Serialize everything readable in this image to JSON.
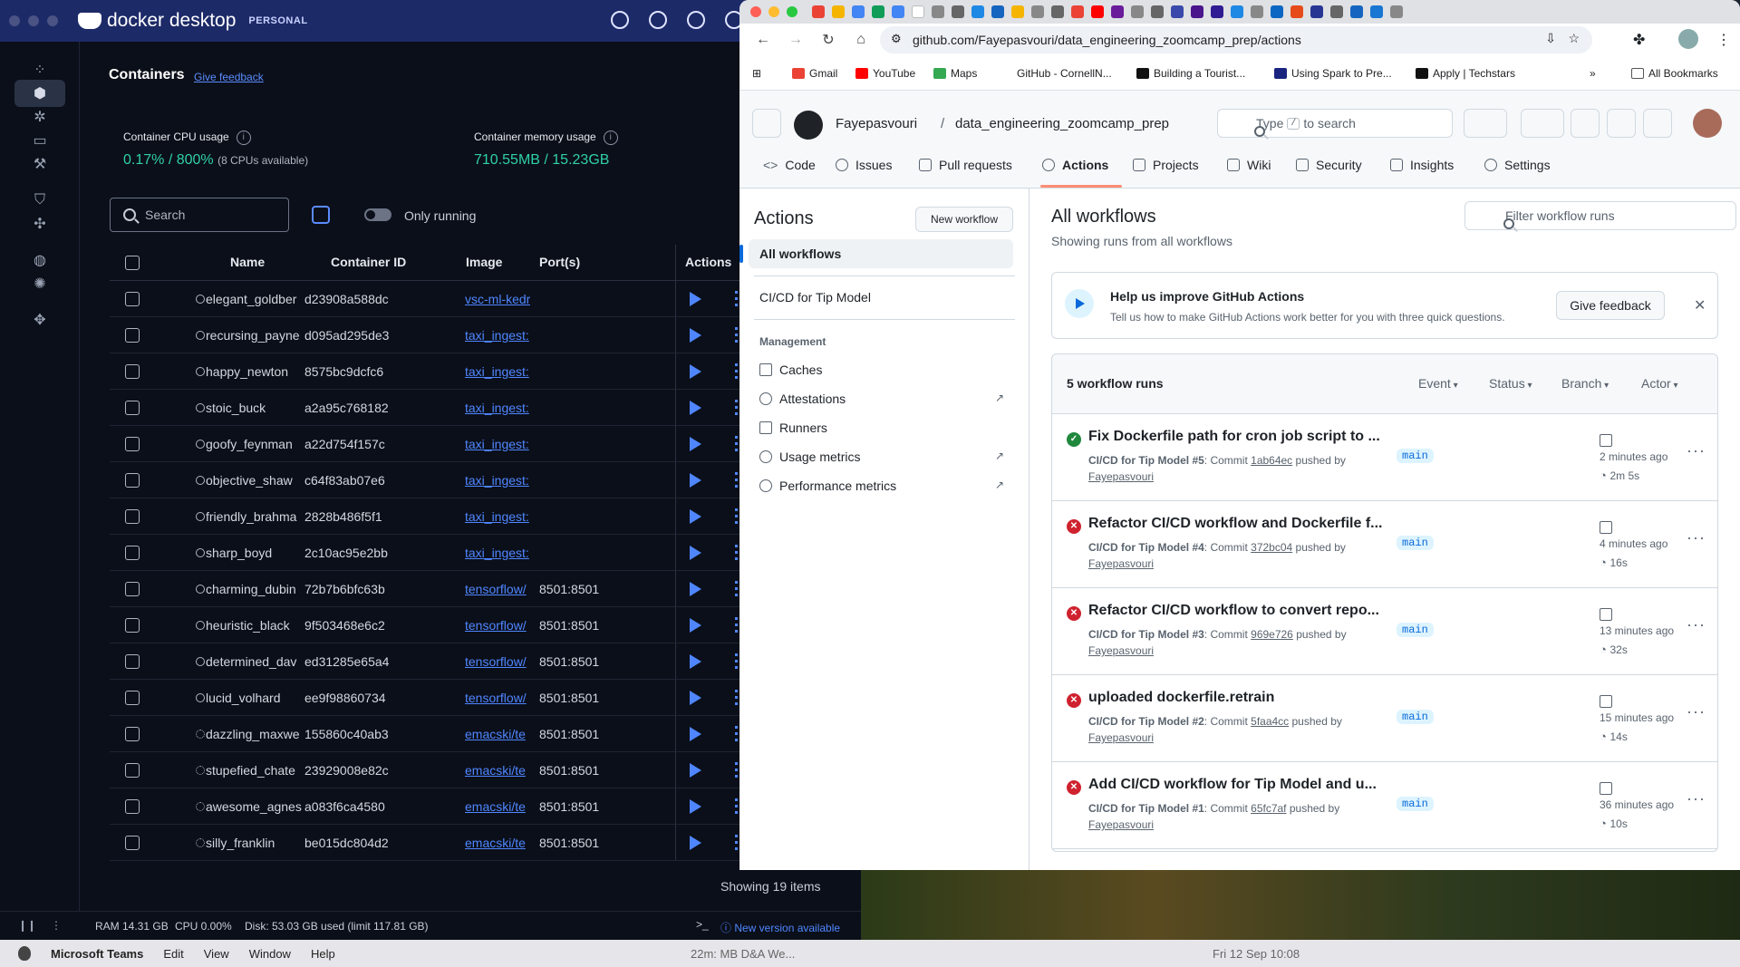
{
  "docker": {
    "brand": "docker desktop",
    "plan": "PERSONAL",
    "section_title": "Containers",
    "feedback_link": "Give feedback",
    "cpu_label": "Container CPU usage",
    "cpu_value": "0.17% / 800%",
    "cpu_note": "(8 CPUs available)",
    "mem_label": "Container memory usage",
    "mem_value": "710.55MB / 15.23GB",
    "search_placeholder": "Search",
    "only_running_label": "Only running",
    "only_running_on": false,
    "columns": [
      "Name",
      "Container ID",
      "Image",
      "Port(s)",
      "Actions"
    ],
    "rows": [
      {
        "name": "elegant_goldber",
        "id": "d23908a588dc",
        "image": "vsc-ml-kedr",
        "ports": ""
      },
      {
        "name": "recursing_payne",
        "id": "d095ad295de3",
        "image": "taxi_ingest:",
        "ports": ""
      },
      {
        "name": "happy_newton",
        "id": "8575bc9dcfc6",
        "image": "taxi_ingest:",
        "ports": ""
      },
      {
        "name": "stoic_buck",
        "id": "a2a95c768182",
        "image": "taxi_ingest:",
        "ports": ""
      },
      {
        "name": "goofy_feynman",
        "id": "a22d754f157c",
        "image": "taxi_ingest:",
        "ports": ""
      },
      {
        "name": "objective_shaw",
        "id": "c64f83ab07e6",
        "image": "taxi_ingest:",
        "ports": ""
      },
      {
        "name": "friendly_brahma",
        "id": "2828b486f5f1",
        "image": "taxi_ingest:",
        "ports": ""
      },
      {
        "name": "sharp_boyd",
        "id": "2c10ac95e2bb",
        "image": "taxi_ingest:",
        "ports": ""
      },
      {
        "name": "charming_dubin",
        "id": "72b7b6bfc63b",
        "image": "tensorflow/",
        "ports": "8501:8501"
      },
      {
        "name": "heuristic_black",
        "id": "9f503468e6c2",
        "image": "tensorflow/",
        "ports": "8501:8501"
      },
      {
        "name": "determined_dav",
        "id": "ed31285e65a4",
        "image": "tensorflow/",
        "ports": "8501:8501"
      },
      {
        "name": "lucid_volhard",
        "id": "ee9f98860734",
        "image": "tensorflow/",
        "ports": "8501:8501"
      },
      {
        "name": "dazzling_maxwe",
        "id": "155860c40ab3",
        "image": "emacski/te",
        "ports": "8501:8501"
      },
      {
        "name": "stupefied_chate",
        "id": "23929008e82c",
        "image": "emacski/te",
        "ports": "8501:8501"
      },
      {
        "name": "awesome_agnes",
        "id": "a083f6ca4580",
        "image": "emacski/te",
        "ports": "8501:8501"
      },
      {
        "name": "silly_franklin",
        "id": "be015dc804d2",
        "image": "emacski/te",
        "ports": "8501:8501"
      }
    ],
    "showing": "Showing 19 items",
    "footer": {
      "ram": "RAM 14.31 GB",
      "cpu": "CPU 0.00%",
      "disk": "Disk: 53.03 GB used (limit 117.81 GB)",
      "update": "New version available"
    }
  },
  "browser": {
    "url": "github.com/Fayepasvouri/data_engineering_zoomcamp_prep/actions",
    "bookmarks": [
      "Gmail",
      "YouTube",
      "Maps",
      "GitHub - CornellN...",
      "Building a Tourist...",
      "Using Spark to Pre...",
      "Apply | Techstars"
    ],
    "all_bookmarks": "All Bookmarks"
  },
  "github": {
    "owner": "Fayepasvouri",
    "repo": "data_engineering_zoomcamp_prep",
    "search": {
      "before": "Type",
      "key": "/",
      "after": "to search"
    },
    "tabs": [
      "Code",
      "Issues",
      "Pull requests",
      "Actions",
      "Projects",
      "Wiki",
      "Security",
      "Insights",
      "Settings"
    ],
    "sidebar": {
      "title": "Actions",
      "new_workflow": "New workflow",
      "all_workflows": "All workflows",
      "workflow": "CI/CD for Tip Model",
      "management": "Management",
      "items": [
        "Caches",
        "Attestations",
        "Runners",
        "Usage metrics",
        "Performance metrics"
      ]
    },
    "main": {
      "title": "All workflows",
      "subtitle": "Showing runs from all workflows",
      "filter_placeholder": "Filter workflow runs",
      "banner_title": "Help us improve GitHub Actions",
      "banner_desc": "Tell us how to make GitHub Actions work better for you with three quick questions.",
      "banner_button": "Give feedback",
      "runs_count": "5 workflow runs",
      "filters": [
        "Event",
        "Status",
        "Branch",
        "Actor"
      ]
    },
    "runs": [
      {
        "status": "success",
        "title": "Fix Dockerfile path for cron job script to ...",
        "workflow": "CI/CD for Tip Model #5",
        "commit": "1ab64ec",
        "actor": "Fayepasvouri",
        "branch": "main",
        "time": "2 minutes ago",
        "duration": "2m 5s"
      },
      {
        "status": "failure",
        "title": "Refactor CI/CD workflow and Dockerfile f...",
        "workflow": "CI/CD for Tip Model #4",
        "commit": "372bc04",
        "actor": "Fayepasvouri",
        "branch": "main",
        "time": "4 minutes ago",
        "duration": "16s"
      },
      {
        "status": "failure",
        "title": "Refactor CI/CD workflow to convert repo...",
        "workflow": "CI/CD for Tip Model #3",
        "commit": "969e726",
        "actor": "Fayepasvouri",
        "branch": "main",
        "time": "13 minutes ago",
        "duration": "32s"
      },
      {
        "status": "failure",
        "title": "uploaded dockerfile.retrain",
        "workflow": "CI/CD for Tip Model #2",
        "commit": "5faa4cc",
        "actor": "Fayepasvouri",
        "branch": "main",
        "time": "15 minutes ago",
        "duration": "14s"
      },
      {
        "status": "failure",
        "title": "Add CI/CD workflow for Tip Model and u...",
        "workflow": "CI/CD for Tip Model #1",
        "commit": "65fc7af",
        "actor": "Fayepasvouri",
        "branch": "main",
        "time": "36 minutes ago",
        "duration": "10s"
      }
    ]
  },
  "menubar": {
    "app": "Microsoft Teams",
    "menus": [
      "Edit",
      "View",
      "Window",
      "Help"
    ],
    "meeting": "22m: MB D&A We...",
    "clock": "Fri 12 Sep  10:08"
  }
}
